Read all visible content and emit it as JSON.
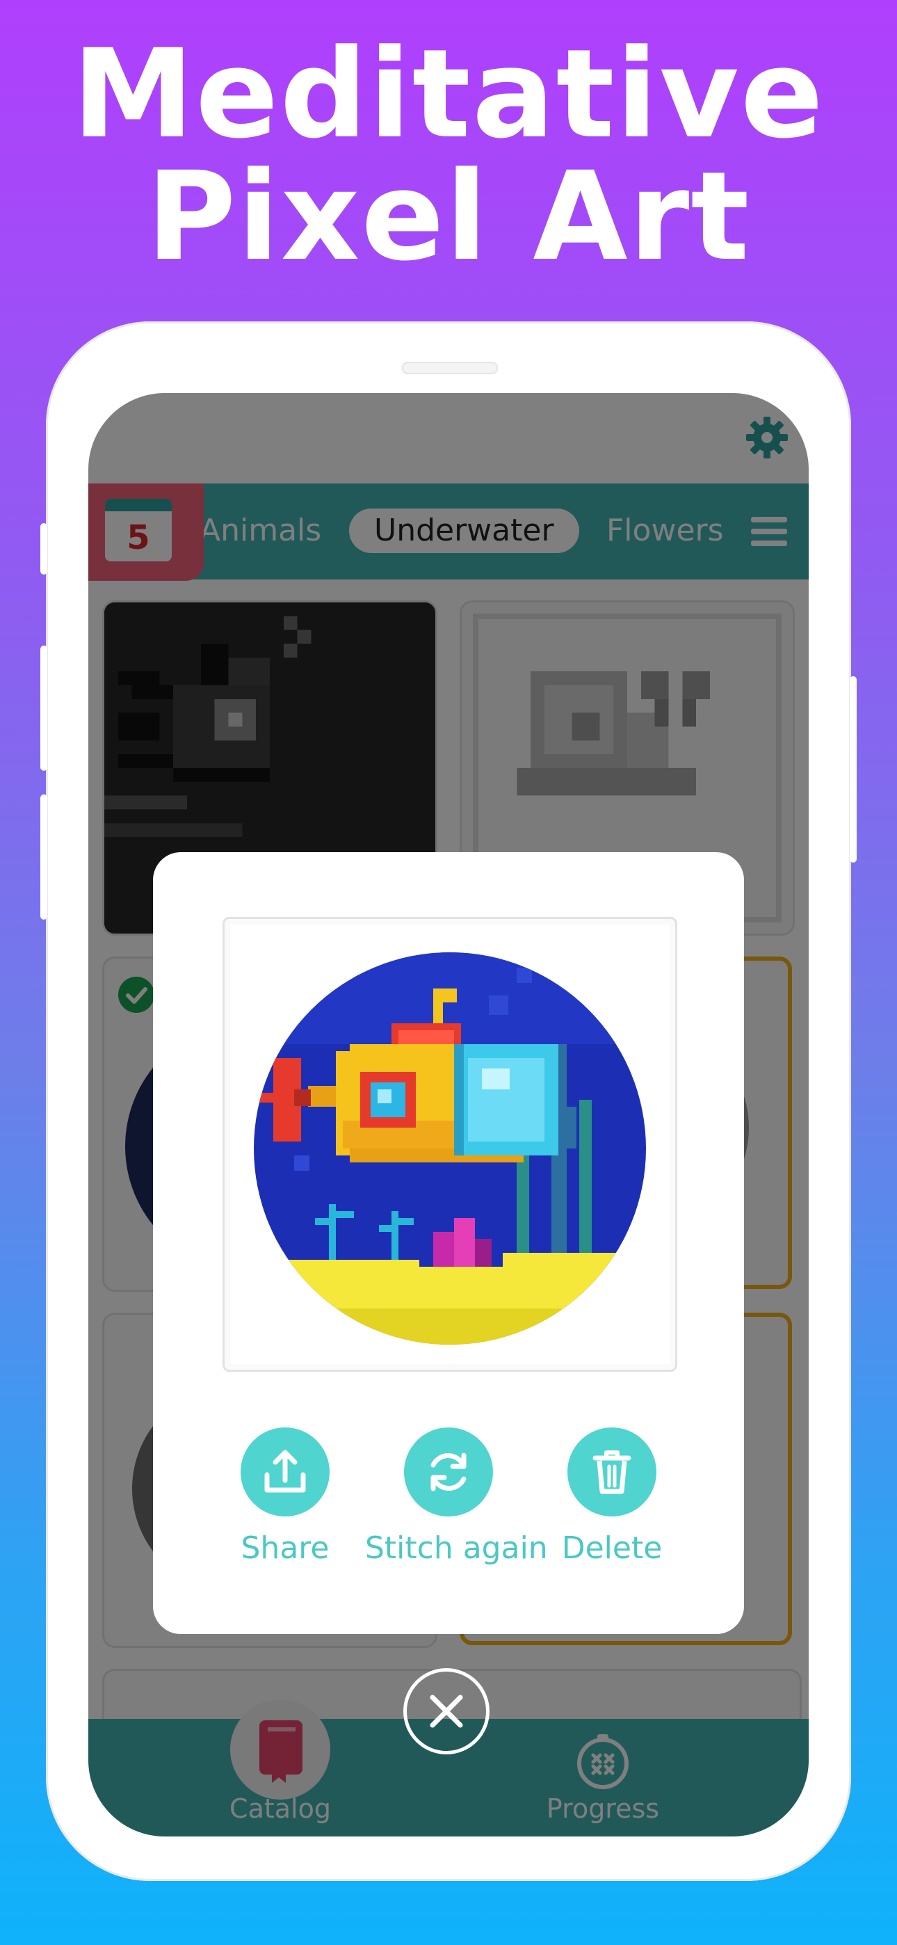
{
  "headline": {
    "line1": "Meditative",
    "line2": "Pixel Art"
  },
  "calendar": {
    "day": "5"
  },
  "categories": [
    {
      "label": "Animals",
      "selected": false
    },
    {
      "label": "Underwater",
      "selected": true
    },
    {
      "label": "Flowers",
      "selected": false
    }
  ],
  "modal": {
    "actions": [
      {
        "label": "Share",
        "icon": "share-icon"
      },
      {
        "label": "Stitch again",
        "icon": "refresh-icon"
      },
      {
        "label": "Delete",
        "icon": "trash-icon"
      }
    ]
  },
  "bottom_nav": [
    {
      "label": "Catalog",
      "icon": "book-icon",
      "active": true
    },
    {
      "label": "Progress",
      "icon": "stitch-hoop-icon",
      "active": false
    }
  ],
  "colors": {
    "teal": "#43b3b2",
    "accent_action": "#4fd4cf",
    "calendar_pink": "#f0617a",
    "gold_frame": "#f1b01a"
  }
}
